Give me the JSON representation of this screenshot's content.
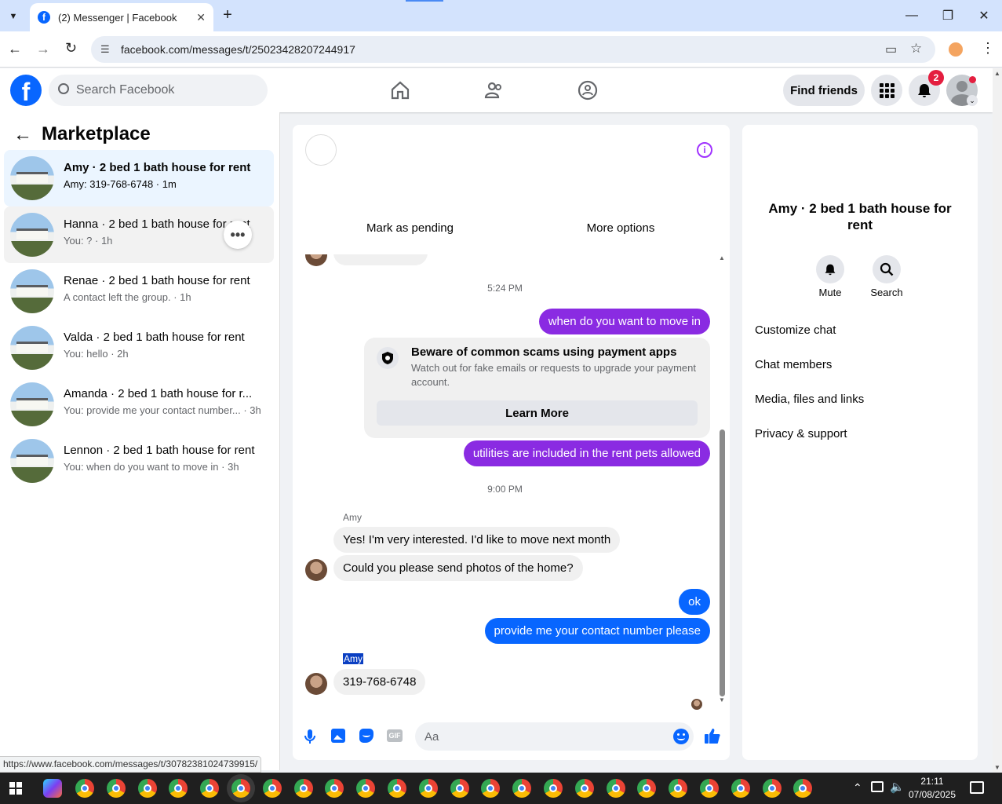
{
  "browser": {
    "tab_title": "(2) Messenger | Facebook",
    "url": "facebook.com/messages/t/25023428207244917",
    "status_url": "https://www.facebook.com/messages/t/30782381024739915/"
  },
  "header": {
    "search_placeholder": "Search Facebook",
    "find_friends": "Find friends",
    "notif_count": "2"
  },
  "sidebar": {
    "title": "Marketplace",
    "conversations": [
      {
        "title": "Amy · 2 bed 1 bath house for rent",
        "preview": "Amy: 319-768-6748 · 1m"
      },
      {
        "title": "Hanna · 2 bed 1 bath house for rent",
        "preview": "You: ? · 1h"
      },
      {
        "title": "Renae · 2 bed 1 bath house for rent",
        "preview": "A contact left the group. · 1h"
      },
      {
        "title": "Valda · 2 bed 1 bath house for rent",
        "preview": "You: hello · 2h"
      },
      {
        "title": "Amanda · 2 bed 1 bath house for r...",
        "preview": "You: provide me your contact number... · 3h"
      },
      {
        "title": "Lennon · 2 bed 1 bath house for rent",
        "preview": "You: when do you want to move in · 3h"
      }
    ]
  },
  "chat": {
    "mark_pending": "Mark as pending",
    "more_options": "More options",
    "time1": "5:24 PM",
    "msg_move_in": "when do you want to move in",
    "scam_title": "Beware of common scams using payment apps",
    "scam_body": "Watch out for fake emails or requests to upgrade your payment account.",
    "learn_more": "Learn More",
    "msg_utilities": "utilities are included in the rent pets allowed",
    "time2": "9:00 PM",
    "sender1": "Amy",
    "msg_interested": "Yes! I'm very interested. I'd like to move next month",
    "msg_photos": "Could you please send photos of the home?",
    "msg_ok": "ok",
    "msg_contact": "provide me your contact number please",
    "sender2": "Amy",
    "msg_number": "319-768-6748",
    "composer_placeholder": "Aa"
  },
  "right_panel": {
    "title": "Amy · 2 bed 1 bath house for rent",
    "mute": "Mute",
    "search": "Search",
    "menu": [
      "Customize chat",
      "Chat members",
      "Media, files and links",
      "Privacy & support"
    ]
  },
  "taskbar": {
    "time": "21:11",
    "date": "07/08/2025"
  }
}
